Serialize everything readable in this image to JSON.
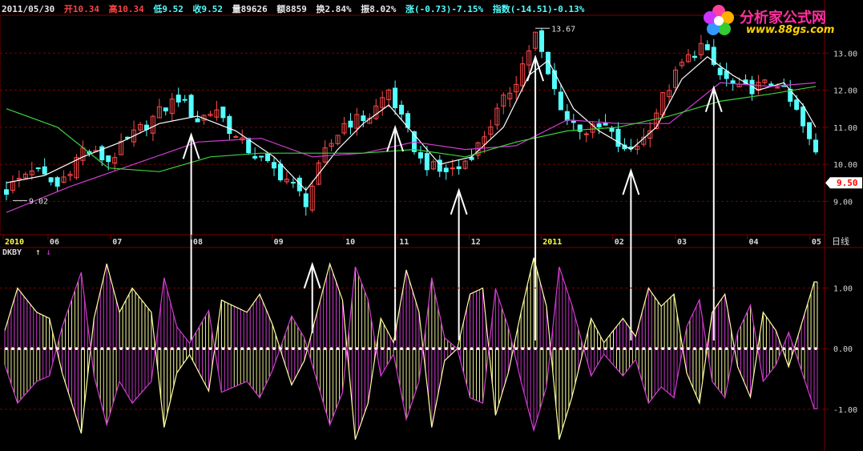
{
  "header": {
    "date": "2011/05/30",
    "open": "开10.34",
    "high": "高10.34",
    "low": "低9.52",
    "close": "收9.52",
    "volume": "量89626",
    "amount": "额8859",
    "turnover": "换2.84%",
    "amplitude": "振8.02%",
    "change": "涨(-0.73)-7.15%",
    "index": "指数(-14.51)-0.13%"
  },
  "logo": {
    "cn": "分析家公式网",
    "url": "www.88gs.com"
  },
  "colors": {
    "bg": "#000000",
    "up": "#ff4a4a",
    "down": "#54ffff",
    "grid": "#7a0000",
    "ma_white": "#ffffff",
    "ma_magenta": "#d23cd2",
    "ma_green": "#3cd23c",
    "hist_yellow": "#ffffa0",
    "hist_magenta": "#d23cd2",
    "price_tag_bg": "#ffffff",
    "price_tag_fg": "#ff0000"
  },
  "chart_data": [
    {
      "type": "candlestick",
      "title": "",
      "x_ticks": [
        "2010",
        "06",
        "07",
        "08",
        "09",
        "10",
        "11",
        "12",
        "2011",
        "02",
        "03",
        "04",
        "05"
      ],
      "period_label": "日线",
      "y_ticks": [
        "13.00",
        "12.00",
        "11.00",
        "10.00",
        "9.00"
      ],
      "ylim": [
        8.1,
        14.0
      ],
      "annotations": {
        "max_label": "13.67",
        "min_label": "9.02",
        "last_price": "9.50"
      },
      "close_path": [
        [
          0,
          9.3
        ],
        [
          4,
          9.9
        ],
        [
          8,
          9.4
        ],
        [
          12,
          10.4
        ],
        [
          16,
          10.1
        ],
        [
          20,
          10.8
        ],
        [
          24,
          11.4
        ],
        [
          27,
          11.8
        ],
        [
          30,
          11.2
        ],
        [
          33,
          11.5
        ],
        [
          36,
          10.7
        ],
        [
          40,
          10.1
        ],
        [
          44,
          9.6
        ],
        [
          47,
          9.0
        ],
        [
          50,
          10.3
        ],
        [
          53,
          11.1
        ],
        [
          57,
          11.3
        ],
        [
          60,
          12.0
        ],
        [
          62,
          11.2
        ],
        [
          65,
          10.1
        ],
        [
          68,
          9.8
        ],
        [
          71,
          9.9
        ],
        [
          74,
          10.5
        ],
        [
          77,
          11.4
        ],
        [
          80,
          12.3
        ],
        [
          83,
          13.5
        ],
        [
          85,
          12.4
        ],
        [
          88,
          11.2
        ],
        [
          91,
          10.9
        ],
        [
          94,
          11.0
        ],
        [
          97,
          10.3
        ],
        [
          100,
          10.7
        ],
        [
          103,
          11.8
        ],
        [
          106,
          12.7
        ],
        [
          109,
          13.2
        ],
        [
          112,
          12.4
        ],
        [
          115,
          12.0
        ],
        [
          118,
          12.1
        ],
        [
          121,
          12.2
        ],
        [
          124,
          11.4
        ],
        [
          126,
          10.6
        ],
        [
          127,
          10.3
        ]
      ],
      "moving_averages": [
        {
          "name": "",
          "color": "#ffffff",
          "points": [
            [
              0,
              9.5
            ],
            [
              6,
              9.7
            ],
            [
              12,
              10.2
            ],
            [
              18,
              10.6
            ],
            [
              24,
              11.1
            ],
            [
              30,
              11.3
            ],
            [
              36,
              10.9
            ],
            [
              42,
              10.2
            ],
            [
              47,
              9.3
            ],
            [
              52,
              10.4
            ],
            [
              56,
              11.1
            ],
            [
              60,
              11.6
            ],
            [
              64,
              10.8
            ],
            [
              68,
              10.0
            ],
            [
              73,
              10.2
            ],
            [
              78,
              11.0
            ],
            [
              82,
              12.4
            ],
            [
              85,
              12.8
            ],
            [
              89,
              11.5
            ],
            [
              93,
              10.9
            ],
            [
              98,
              10.4
            ],
            [
              102,
              11.0
            ],
            [
              106,
              12.3
            ],
            [
              110,
              12.9
            ],
            [
              114,
              12.4
            ],
            [
              118,
              12.0
            ],
            [
              122,
              12.2
            ],
            [
              125,
              11.6
            ],
            [
              127,
              11.0
            ]
          ]
        },
        {
          "name": "",
          "color": "#d23cd2",
          "points": [
            [
              0,
              8.7
            ],
            [
              10,
              9.4
            ],
            [
              20,
              10.0
            ],
            [
              30,
              10.6
            ],
            [
              40,
              10.7
            ],
            [
              48,
              10.2
            ],
            [
              56,
              10.3
            ],
            [
              64,
              10.6
            ],
            [
              72,
              10.4
            ],
            [
              80,
              10.5
            ],
            [
              88,
              11.2
            ],
            [
              96,
              11.1
            ],
            [
              104,
              11.1
            ],
            [
              112,
              12.2
            ],
            [
              120,
              12.1
            ],
            [
              127,
              12.2
            ]
          ]
        },
        {
          "name": "",
          "color": "#3cd23c",
          "points": [
            [
              0,
              11.5
            ],
            [
              8,
              11.0
            ],
            [
              16,
              9.9
            ],
            [
              24,
              9.8
            ],
            [
              32,
              10.2
            ],
            [
              40,
              10.3
            ],
            [
              48,
              10.3
            ],
            [
              56,
              10.3
            ],
            [
              64,
              10.4
            ],
            [
              72,
              10.2
            ],
            [
              80,
              10.6
            ],
            [
              88,
              10.9
            ],
            [
              96,
              11.0
            ],
            [
              104,
              11.3
            ],
            [
              112,
              11.7
            ],
            [
              120,
              11.9
            ],
            [
              127,
              12.1
            ]
          ]
        }
      ],
      "markers_up_at": [
        29,
        61,
        71,
        83,
        98,
        111
      ]
    },
    {
      "type": "bar",
      "title": "DKBY",
      "legend_up_arrow": "↑",
      "legend_down_arrow": "↓",
      "y_ticks": [
        "1.00",
        "0.00",
        "-1.00"
      ],
      "ylim": [
        -1.65,
        1.55
      ],
      "oscillation_envelope": [
        [
          0,
          0.3
        ],
        [
          2,
          1.0
        ],
        [
          5,
          0.6
        ],
        [
          7,
          0.5
        ],
        [
          9,
          -0.4
        ],
        [
          12,
          -1.4
        ],
        [
          14,
          0.5
        ],
        [
          16,
          1.4
        ],
        [
          18,
          0.6
        ],
        [
          20,
          1.0
        ],
        [
          23,
          0.6
        ],
        [
          25,
          -1.3
        ],
        [
          27,
          -0.4
        ],
        [
          29,
          -0.1
        ],
        [
          32,
          -0.7
        ],
        [
          34,
          0.8
        ],
        [
          36,
          0.7
        ],
        [
          38,
          0.6
        ],
        [
          40,
          0.9
        ],
        [
          42,
          0.4
        ],
        [
          45,
          -0.6
        ],
        [
          47,
          -0.2
        ],
        [
          49,
          0.6
        ],
        [
          51,
          1.4
        ],
        [
          53,
          0.8
        ],
        [
          55,
          -1.5
        ],
        [
          57,
          -0.9
        ],
        [
          59,
          0.5
        ],
        [
          61,
          0.1
        ],
        [
          63,
          1.3
        ],
        [
          65,
          0.6
        ],
        [
          67,
          -1.3
        ],
        [
          69,
          -0.2
        ],
        [
          71,
          0.0
        ],
        [
          73,
          0.9
        ],
        [
          75,
          1.0
        ],
        [
          77,
          -1.1
        ],
        [
          79,
          -0.4
        ],
        [
          81,
          0.6
        ],
        [
          83,
          1.5
        ],
        [
          85,
          0.7
        ],
        [
          87,
          -1.5
        ],
        [
          89,
          -0.8
        ],
        [
          92,
          0.5
        ],
        [
          94,
          0.1
        ],
        [
          97,
          0.5
        ],
        [
          99,
          0.2
        ],
        [
          101,
          1.0
        ],
        [
          103,
          0.7
        ],
        [
          105,
          0.9
        ],
        [
          107,
          -0.4
        ],
        [
          109,
          -0.9
        ],
        [
          111,
          0.6
        ],
        [
          113,
          0.9
        ],
        [
          115,
          -0.3
        ],
        [
          117,
          -0.8
        ],
        [
          119,
          0.6
        ],
        [
          121,
          0.3
        ],
        [
          123,
          -0.3
        ],
        [
          125,
          0.4
        ],
        [
          127,
          1.1
        ]
      ],
      "markers_up_at": [
        29,
        48,
        61,
        71,
        83,
        98,
        111
      ]
    }
  ]
}
